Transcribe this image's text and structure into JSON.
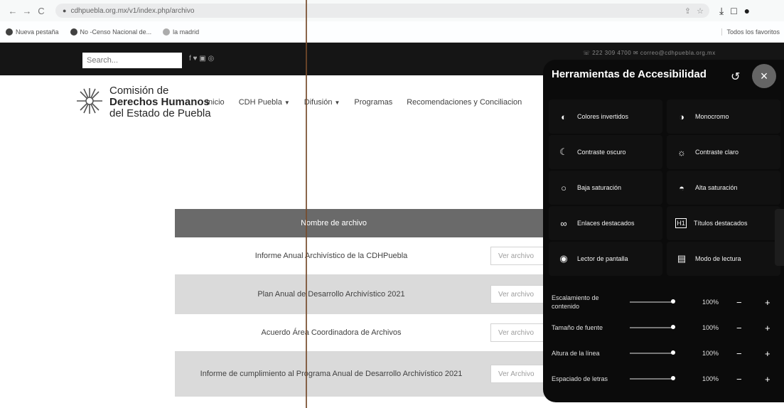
{
  "browser": {
    "url": "cdhpuebla.org.mx/v1/index.php/archivo",
    "bookmarks": [
      "Nueva pestaña",
      "No -Censo Nacional de...",
      "la madrid"
    ],
    "bookmarks_right": "Todos los favoritos"
  },
  "site": {
    "search_placeholder": "Search...",
    "social_icons": "f  ♥  ▣  ◎",
    "contact": "☏ 222 309 4700   ✉ correo@cdhpuebla.org.mx",
    "logo": {
      "line1": "Comisión de",
      "line2": "Derechos Humanos",
      "line3": "del Estado de Puebla"
    },
    "nav": [
      "Inicio",
      "CDH Puebla",
      "Difusión",
      "Programas",
      "Recomendaciones y Conciliacion"
    ]
  },
  "table": {
    "header": "Nombre de archivo",
    "rows": [
      {
        "name": "Informe Anual Archivístico de la CDHPuebla",
        "button": "Ver archivo"
      },
      {
        "name": "Plan Anual de Desarrollo Archivístico 2021",
        "button": "Ver archivo"
      },
      {
        "name": "Acuerdo Área Coordinadora de Archivos",
        "button": "Ver archivo"
      },
      {
        "name": "Informe de cumplimiento al Programa Anual de Desarrollo Archivístico 2021",
        "button": "Ver Archivo"
      }
    ]
  },
  "accessibility": {
    "title": "Herramientas de Accesibilidad",
    "options": [
      {
        "label": "Colores invertidos",
        "icon": "half-circle-icon"
      },
      {
        "label": "Monocromo",
        "icon": "monochrome-icon"
      },
      {
        "label": "Contraste oscuro",
        "icon": "moon-icon"
      },
      {
        "label": "Contraste claro",
        "icon": "sun-icon"
      },
      {
        "label": "Baja saturación",
        "icon": "circle-outline-icon"
      },
      {
        "label": "Alta saturación",
        "icon": "half-filled-circle-icon"
      },
      {
        "label": "Enlaces destacados",
        "icon": "link-icon"
      },
      {
        "label": "Títulos destacados",
        "icon": "h1-icon"
      },
      {
        "label": "Lector de pantalla",
        "icon": "pulse-icon"
      },
      {
        "label": "Modo de lectura",
        "icon": "document-icon"
      }
    ],
    "sliders": [
      {
        "label": "Escalamiento de contenido",
        "value": "100%"
      },
      {
        "label": "Tamaño de fuente",
        "value": "100%"
      },
      {
        "label": "Altura de la línea",
        "value": "100%"
      },
      {
        "label": "Espaciado de letras",
        "value": "100%"
      }
    ],
    "minus": "−",
    "plus": "+"
  }
}
